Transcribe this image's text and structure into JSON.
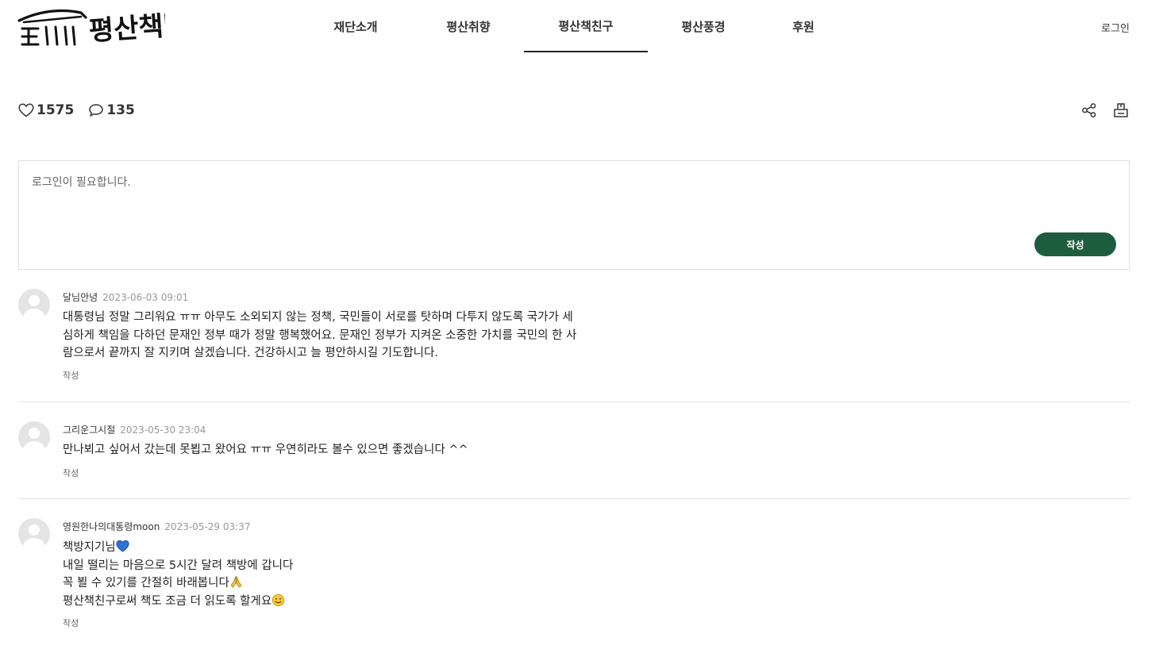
{
  "header": {
    "logo_text": "평산책방",
    "nav": [
      {
        "label": "재단소개"
      },
      {
        "label": "평산취향"
      },
      {
        "label": "평산책친구",
        "active": true
      },
      {
        "label": "평산풍경"
      },
      {
        "label": "후원"
      }
    ],
    "login_label": "로그인"
  },
  "stats": {
    "likes": "1575",
    "comments": "135"
  },
  "actions": {
    "share_icon": "share-icon",
    "print_icon": "print-icon"
  },
  "comment_form": {
    "placeholder": "로그인이 필요합니다.",
    "submit_label": "작성",
    "submit_color": "#1e5c3e"
  },
  "comments": [
    {
      "author": "달님안녕",
      "date": "2023-06-03 09:01",
      "text": "대통령님 정말 그리워요 ㅠㅠ 아무도 소외되지 않는 정책, 국민들이 서로를 탓하며 다투지 않도록 국가가 세\n심하게 책임을 다하던 문재인 정부 때가 정말 행복했어요. 문재인 정부가 지켜온 소중한 가치를 국민의 한 사\n람으로서 끝까지 잘 지키며 살겠습니다. 건강하시고 늘 평안하시길 기도합니다.",
      "reply_label": "작성"
    },
    {
      "author": "그리운그시절",
      "date": "2023-05-30 23:04",
      "text": "만나뵈고 싶어서 갔는데 못뵙고 왔어요 ㅠㅠ 우연히라도 볼수 있으면 좋겠습니다 ^^",
      "reply_label": "작성"
    },
    {
      "author": "영원한나의대통령moon",
      "date": "2023-05-29 03:37",
      "lines": [
        {
          "text": "책방지기님",
          "emoji": "blue-heart-icon"
        },
        {
          "text": "내일 떨리는 마음으로 5시간 달려 책방에 갑니다"
        },
        {
          "text": "꼭 뵐 수 있기를 간절히 바래봅니다",
          "emoji": "folded-hands-icon"
        },
        {
          "text": "평산책친구로써 책도 조금 더 읽도록 할게요",
          "emoji": "smiling-face-icon"
        }
      ],
      "reply_label": "작성"
    }
  ]
}
